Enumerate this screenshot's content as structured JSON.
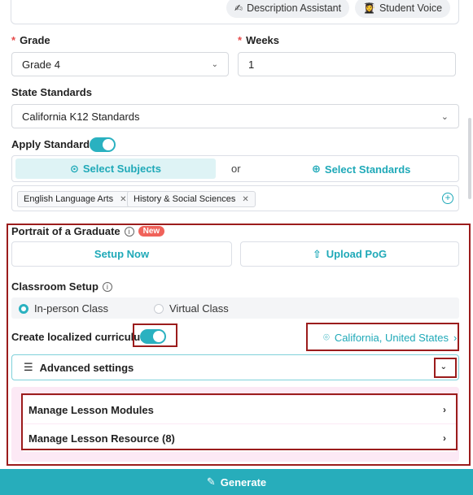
{
  "assistants": {
    "description_assistant": "Description Assistant",
    "student_voice": "Student Voice"
  },
  "grade": {
    "label": "Grade",
    "value": "Grade 4"
  },
  "weeks": {
    "label": "Weeks",
    "value": "1"
  },
  "state_standards": {
    "label": "State Standards",
    "value": "California K12 Standards"
  },
  "apply_standards": {
    "label": "Apply Standards",
    "enabled": true,
    "select_subjects": "Select Subjects",
    "or": "or",
    "select_standards": "Select Standards"
  },
  "subjects": [
    {
      "label": "English Language Arts"
    },
    {
      "label": "History & Social Sciences"
    }
  ],
  "portrait": {
    "label": "Portrait of a Graduate",
    "badge": "New",
    "setup_now": "Setup Now",
    "upload_pog": "Upload PoG"
  },
  "classroom_setup": {
    "label": "Classroom Setup",
    "options": [
      "In-person Class",
      "Virtual Class"
    ],
    "selected": "In-person Class"
  },
  "localized": {
    "label": "Create localized curriculum",
    "enabled": true,
    "location": "California, United States"
  },
  "advanced": {
    "label": "Advanced settings"
  },
  "manage": {
    "modules": "Manage Lesson Modules",
    "resources": "Manage Lesson Resource (8)"
  },
  "generate": "Generate",
  "colors": {
    "accent": "#2ab1c0",
    "highlight_border": "#9b1c1c",
    "required": "#e64b4b",
    "badge": "#f0625a"
  }
}
